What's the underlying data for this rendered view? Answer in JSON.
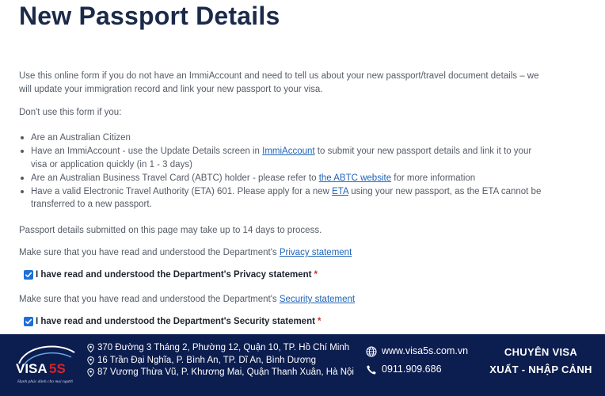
{
  "page": {
    "title": "New Passport Details",
    "intro": "Use this online form if you do not have an ImmiAccount and need to tell us about your new passport/travel document details – we will update your immigration record and link your new passport to your visa.",
    "dont_use": "Don't use this form if you:",
    "bullets": {
      "b1": "Are an Australian Citizen",
      "b2_pre": "Have an ImmiAccount - use the Update Details screen in ",
      "b2_link": "ImmiAccount",
      "b2_post": " to submit your new passport details and link it to your visa or application quickly (in 1 - 3 days)",
      "b3_pre": "Are an Australian Business Travel Card (ABTC) holder - please refer to ",
      "b3_link": "the ABTC website",
      "b3_post": " for more information",
      "b4_pre": "Have a valid Electronic Travel Authority (ETA) 601. Please apply for a new ",
      "b4_link": "ETA",
      "b4_post": " using your new passport, as the ETA cannot be transferred to a new passport."
    },
    "process_note": "Passport details submitted on this page may take up to 14 days to process.",
    "privacy_pre": "Make sure that you have read and understood the Department's ",
    "privacy_link": "Privacy statement",
    "privacy_check": "I have read and understood the Department's Privacy statement",
    "security_pre": "Make sure that you have read and understood the Department's ",
    "security_link": "Security statement",
    "security_check": "I have read and understood the Department's Security statement",
    "required_mark": "*",
    "privacy_checked": true,
    "security_checked": true
  },
  "footer": {
    "brand": "VISA5S",
    "tagline": "Hạnh phúc dành cho mọi người",
    "address1": "370 Đường 3 Tháng 2, Phường 12, Quận 10, TP. Hồ Chí Minh",
    "address2": "16 Trần Đại Nghĩa, P. Bình An, TP. Dĩ An, Bình Dương",
    "address3": "87 Vương Thừa Vũ, P. Khương Mai, Quận Thanh Xuân, Hà Nội",
    "website": "www.visa5s.com.vn",
    "phone": "0911.909.686",
    "service1": "CHUYÊN VISA",
    "service2": "XUẤT - NHẬP CẢNH",
    "colors": {
      "footer_bg": "#0c1d4f",
      "brand_red": "#d8232a",
      "link": "#2064b8",
      "checkbox": "#1e6fd9"
    },
    "icons": [
      "location-pin-icon",
      "globe-icon",
      "phone-icon",
      "checkmark-icon"
    ]
  }
}
